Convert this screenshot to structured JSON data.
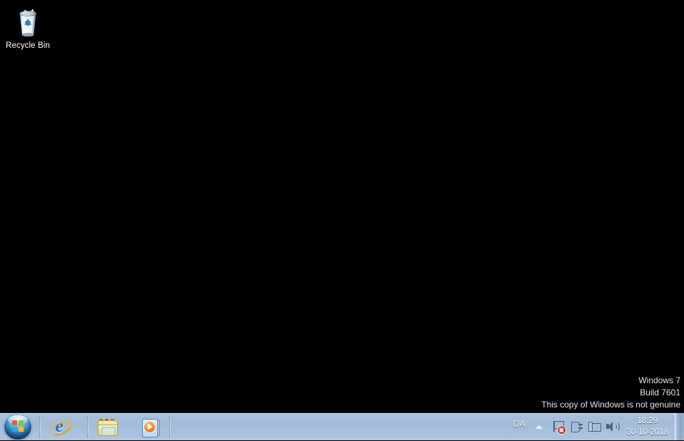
{
  "desktop": {
    "background_color": "#000000",
    "icons": [
      {
        "name": "recycle-bin",
        "label": "Recycle Bin",
        "icon": "recycle-bin-icon"
      }
    ]
  },
  "watermark": {
    "line1": "Windows 7",
    "line2": "Build 7601",
    "line3": "This copy of Windows is not genuine",
    "color": "#dfe4ea"
  },
  "taskbar": {
    "background_color": "#a6bedb",
    "start_button": {
      "label": "Start",
      "icon": "windows-orb-icon"
    },
    "pinned": [
      {
        "name": "internet-explorer",
        "label": "Internet Explorer",
        "icon": "internet-explorer-icon"
      },
      {
        "name": "windows-explorer",
        "label": "Windows Explorer",
        "icon": "folder-icon"
      },
      {
        "name": "windows-media-player",
        "label": "Windows Media Player",
        "icon": "media-player-icon"
      }
    ],
    "tray": {
      "language": "DA",
      "show_hidden_icons": {
        "label": "Show hidden icons",
        "icon": "chevron-up-icon"
      },
      "icons": [
        {
          "name": "action-center",
          "label": "Action Center",
          "icon": "flag-alert-icon"
        },
        {
          "name": "power-options",
          "label": "Power",
          "icon": "power-plug-icon"
        },
        {
          "name": "network",
          "label": "Network",
          "icon": "network-icon"
        },
        {
          "name": "volume",
          "label": "Volume",
          "icon": "speaker-icon"
        }
      ],
      "clock": {
        "time": "18:29",
        "date": "30-10-2018"
      },
      "show_desktop": {
        "label": "Show desktop"
      }
    }
  }
}
